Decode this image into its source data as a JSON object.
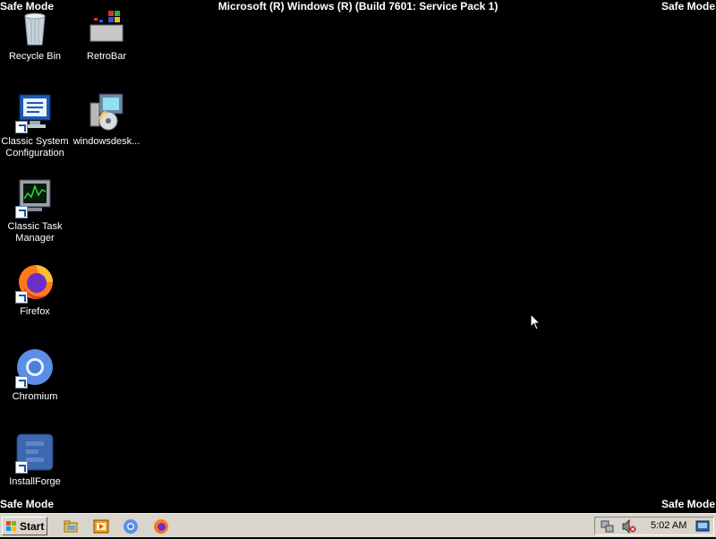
{
  "safe_mode_label": "Safe Mode",
  "banner": "Microsoft (R) Windows (R) (Build 7601: Service Pack 1)",
  "icons": [
    {
      "label": "Recycle Bin",
      "icon": "recycle-bin-icon"
    },
    {
      "label": "RetroBar",
      "icon": "retrobar-icon"
    },
    {
      "label": "Classic System Configuration",
      "icon": "system-config-icon"
    },
    {
      "label": "windowsdesk...",
      "icon": "installer-icon"
    },
    {
      "label": "Classic Task Manager",
      "icon": "task-manager-icon"
    },
    {
      "label": "Firefox",
      "icon": "firefox-icon"
    },
    {
      "label": "Chromium",
      "icon": "chromium-icon"
    },
    {
      "label": "InstallForge",
      "icon": "installforge-icon"
    }
  ],
  "taskbar": {
    "start_label": "Start",
    "quick_launch": [
      "explorer-icon",
      "media-player-icon",
      "chromium-icon",
      "firefox-icon"
    ],
    "clock": "5:02 AM"
  },
  "colors": {
    "desktop": "#000000",
    "taskbar": "#d9d5cc"
  }
}
